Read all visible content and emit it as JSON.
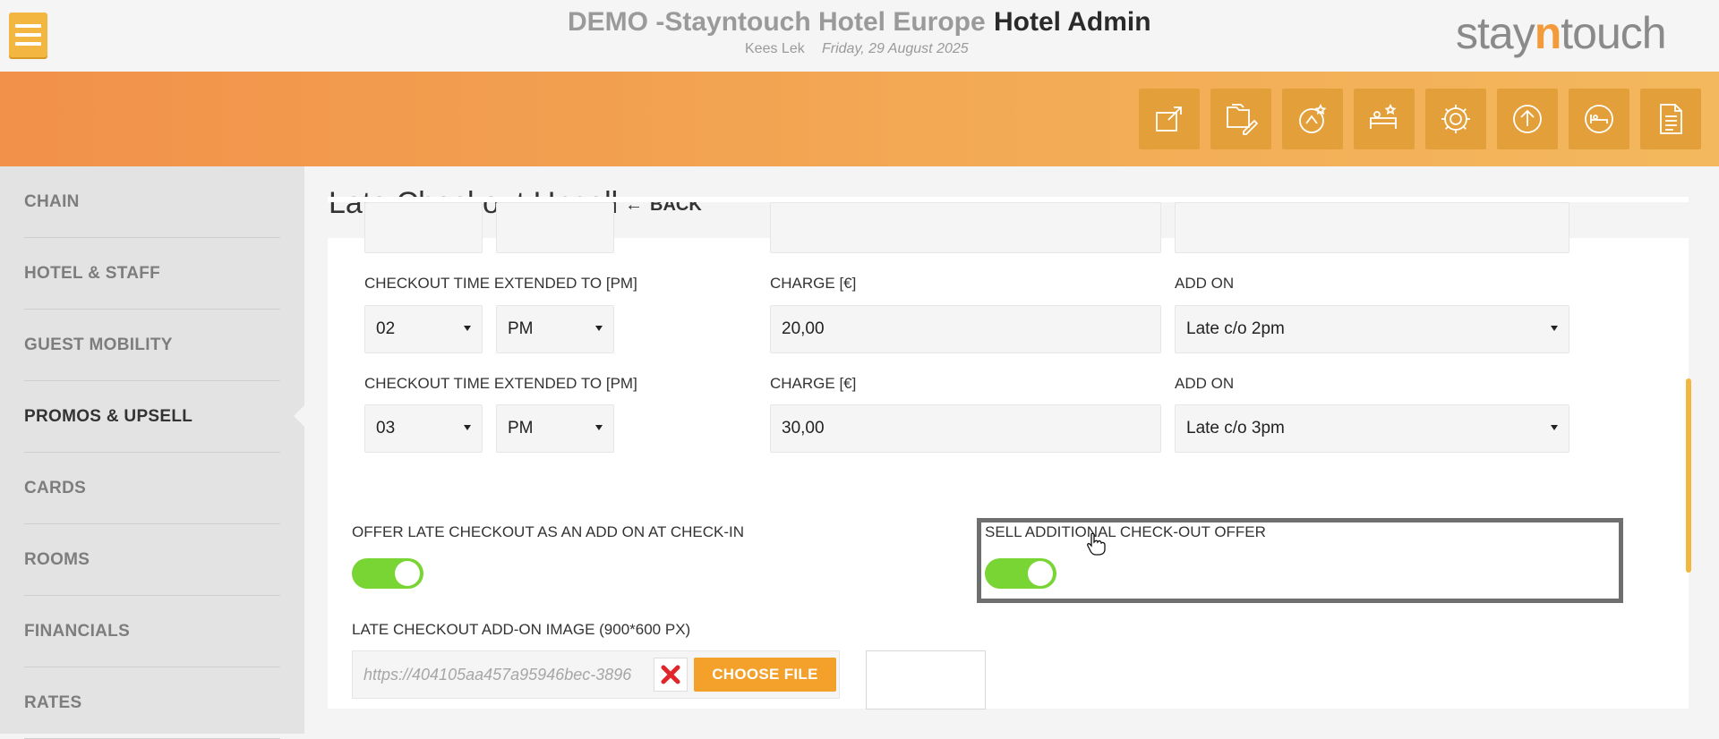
{
  "header": {
    "hotel_name": "DEMO -Stayntouch Hotel Europe",
    "app_name": "Hotel Admin",
    "user": "Kees Lek",
    "date": "Friday, 29 August 2025",
    "logo_prefix": "stay",
    "logo_n": "n",
    "logo_suffix": "touch"
  },
  "toolbar": {
    "icons": [
      "external-link-icon",
      "folder-edit-icon",
      "upsell-star-icon",
      "housekeeping-icon",
      "gear-icon",
      "upload-icon",
      "bed-icon",
      "document-icon"
    ]
  },
  "sidebar": {
    "items": [
      {
        "label": "CHAIN"
      },
      {
        "label": "HOTEL & STAFF"
      },
      {
        "label": "GUEST MOBILITY"
      },
      {
        "label": "PROMOS & UPSELL",
        "active": true
      },
      {
        "label": "CARDS"
      },
      {
        "label": "ROOMS"
      },
      {
        "label": "FINANCIALS"
      },
      {
        "label": "RATES"
      }
    ]
  },
  "page": {
    "title": "Late Checkout Upsell",
    "back_label": "BACK"
  },
  "rows": [
    {
      "time_label": "CHECKOUT TIME EXTENDED TO [PM]",
      "hour": "02",
      "ampm": "PM",
      "charge_label": "CHARGE [€]",
      "charge": "20,00",
      "addon_label": "ADD ON",
      "addon": "Late c/o 2pm"
    },
    {
      "time_label": "CHECKOUT TIME EXTENDED TO [PM]",
      "hour": "03",
      "ampm": "PM",
      "charge_label": "CHARGE [€]",
      "charge": "30,00",
      "addon_label": "ADD ON",
      "addon": "Late c/o 3pm"
    }
  ],
  "toggles": {
    "offer_late_checkout_label": "OFFER LATE CHECKOUT AS AN ADD ON AT CHECK-IN",
    "offer_late_checkout_on": true,
    "sell_additional_label": "SELL ADDITIONAL CHECK-OUT OFFER",
    "sell_additional_on": true
  },
  "image_upload": {
    "label": "LATE CHECKOUT ADD-ON IMAGE (900*600 PX)",
    "value": "https://404105aa457a95946bec-3896",
    "choose_label": "CHOOSE FILE"
  },
  "colors": {
    "accent": "#f3a12a",
    "toggle_on": "#78d534"
  }
}
